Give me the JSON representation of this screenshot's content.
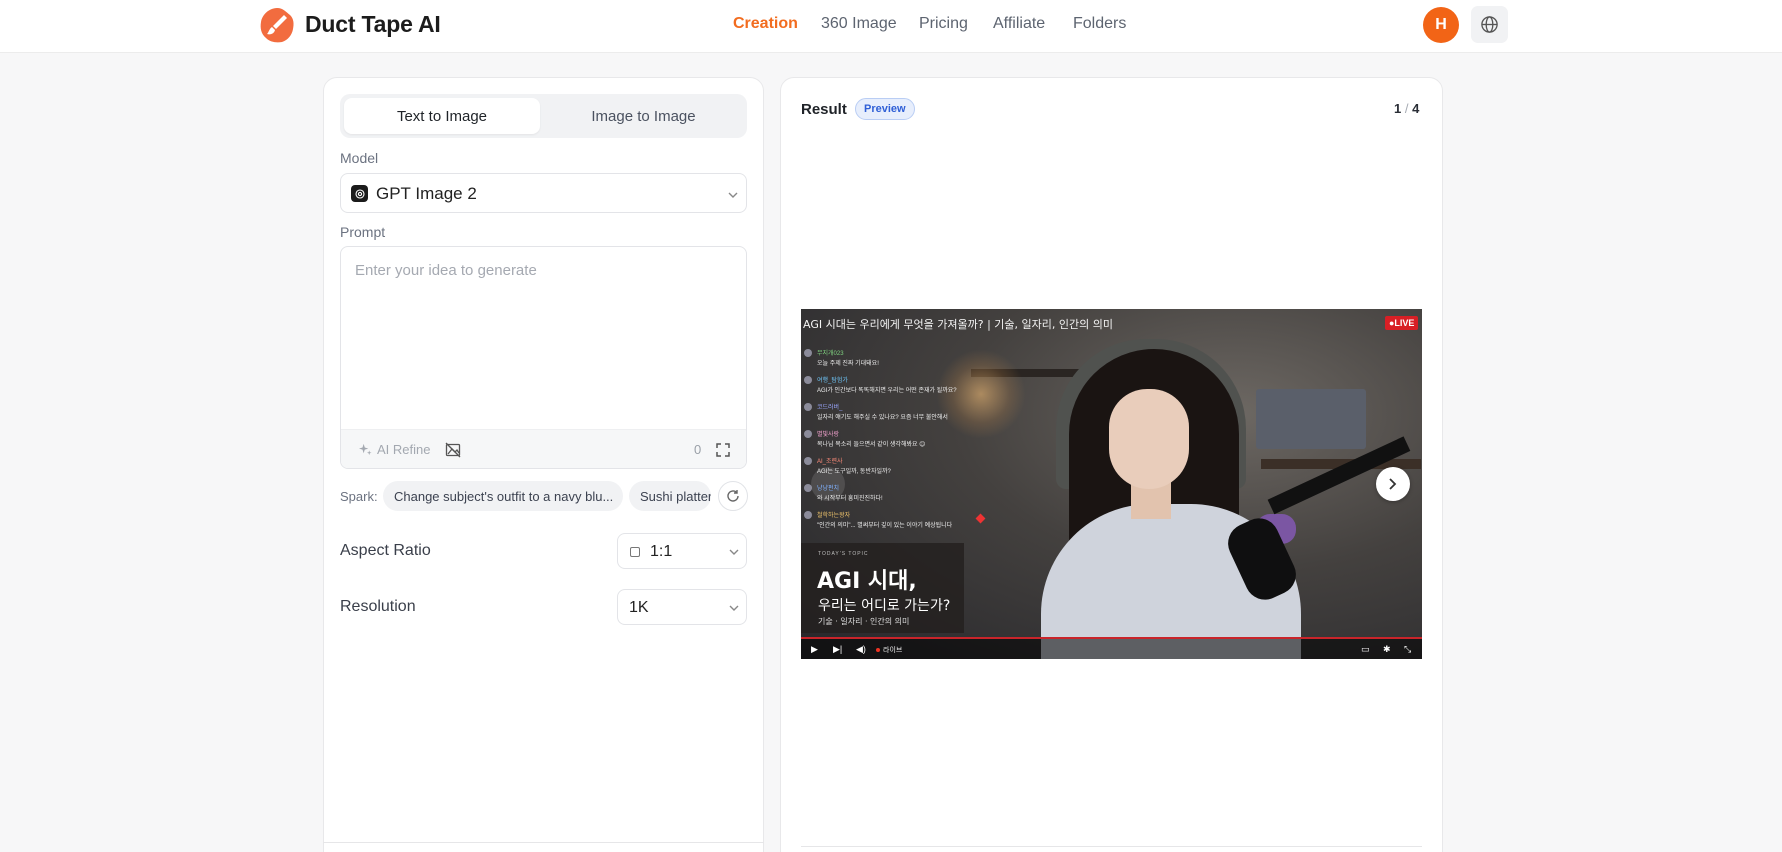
{
  "header": {
    "brand": "Duct Tape AI",
    "nav": [
      {
        "label": "Creation",
        "active": true
      },
      {
        "label": "360 Image",
        "active": false
      },
      {
        "label": "Pricing",
        "active": false
      },
      {
        "label": "Affiliate",
        "active": false
      },
      {
        "label": "Folders",
        "active": false
      }
    ],
    "avatar_initial": "H",
    "icons": {
      "logo": "brush-logo-icon",
      "language": "globe-icon"
    },
    "accent_color": "#f26c1f"
  },
  "left": {
    "tabs": [
      {
        "label": "Text to Image",
        "active": true
      },
      {
        "label": "Image to Image",
        "active": false
      }
    ],
    "model_label": "Model",
    "model_value": "GPT Image 2",
    "prompt_label": "Prompt",
    "prompt_placeholder": "Enter your idea to generate",
    "prompt_value": "",
    "ai_refine_label": "AI Refine",
    "char_count": "0",
    "spark_label": "Spark:",
    "spark_chips": [
      "Change subject's outfit to a navy blu...",
      "Sushi platter"
    ],
    "aspect_ratio_label": "Aspect Ratio",
    "aspect_ratio_value": "1:1",
    "resolution_label": "Resolution",
    "resolution_value": "1K"
  },
  "right": {
    "result_label": "Result",
    "preview_badge": "Preview",
    "pager_current": "1",
    "pager_separator": "/",
    "pager_total": "4",
    "image": {
      "stream_title": "AGI 시대는 우리에게 무엇을 가져올까? | 기술, 일자리, 인간의 의미",
      "live_badge": "●LIVE",
      "chat": [
        {
          "name": "무지개023",
          "message": "오늘 주제 진짜 기대돼요!",
          "color": "#7fd17f"
        },
        {
          "name": "여행_탐험가",
          "message": "AGI가 인간보다 똑똑해지면 우리는 어떤 존재가 될까요?",
          "color": "#6ec3f5"
        },
        {
          "name": "코드러버_",
          "message": "일자리 얘기도 해주실 수 있나요? 요즘 너무 불안해서",
          "color": "#9aa6ff"
        },
        {
          "name": "별빛사랑",
          "message": "목나님 목소리 들으면서 같이 생각해봐요 😊",
          "color": "#f5a3d0"
        },
        {
          "name": "AI_조련사",
          "message": "AGI는 도구일까, 동반자일까?",
          "color": "#ff8c7a"
        },
        {
          "name": "냥냥펀치",
          "message": "와 시작부터 흥미진진하다!",
          "color": "#6fa8ff"
        },
        {
          "name": "철학하는왕자",
          "message": "\"인간의 의미\"... 별써부터 깊이 있는 이야기 예상됩니다",
          "color": "#f2c66d"
        }
      ],
      "topic_tag": "TODAY'S TOPIC",
      "topic_line1": "AGI 시대,",
      "topic_line2": "우리는 어디로 가는가?",
      "topic_sub": "기술 · 일자리 · 인간의 의미",
      "player_live": "라이브"
    }
  }
}
